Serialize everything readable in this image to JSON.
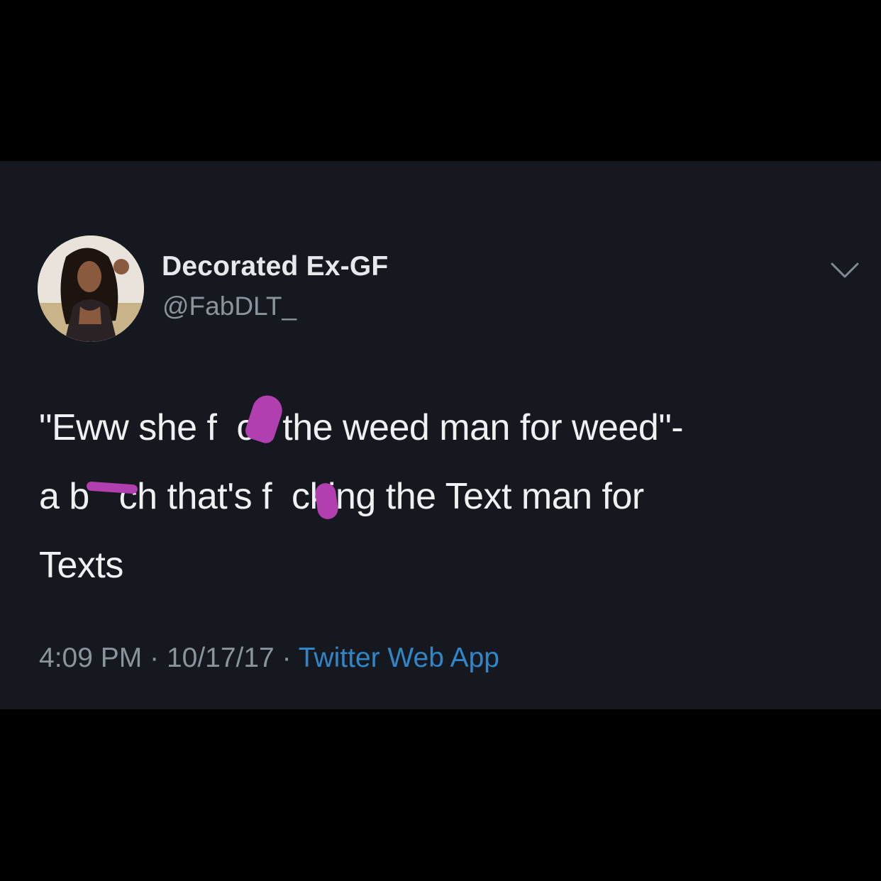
{
  "tweet": {
    "display_name": "Decorated Ex-GF",
    "handle": "@FabDLT_",
    "text_lines": [
      "\"Eww she f  ck the weed man for weed\"-",
      "a b   ch that's f  cking the Text man for",
      "Texts"
    ],
    "time": "4:09 PM",
    "date": "10/17/17",
    "separator": "·",
    "source": "Twitter Web App"
  },
  "icons": {
    "avatar": "profile-photo",
    "menu": "chevron-down-icon"
  },
  "colors": {
    "background": "#000000",
    "card": "#15181f",
    "text": "#eef0f2",
    "secondary": "#8a949c",
    "link": "#2f86c8",
    "censor": "#b23fb0"
  }
}
